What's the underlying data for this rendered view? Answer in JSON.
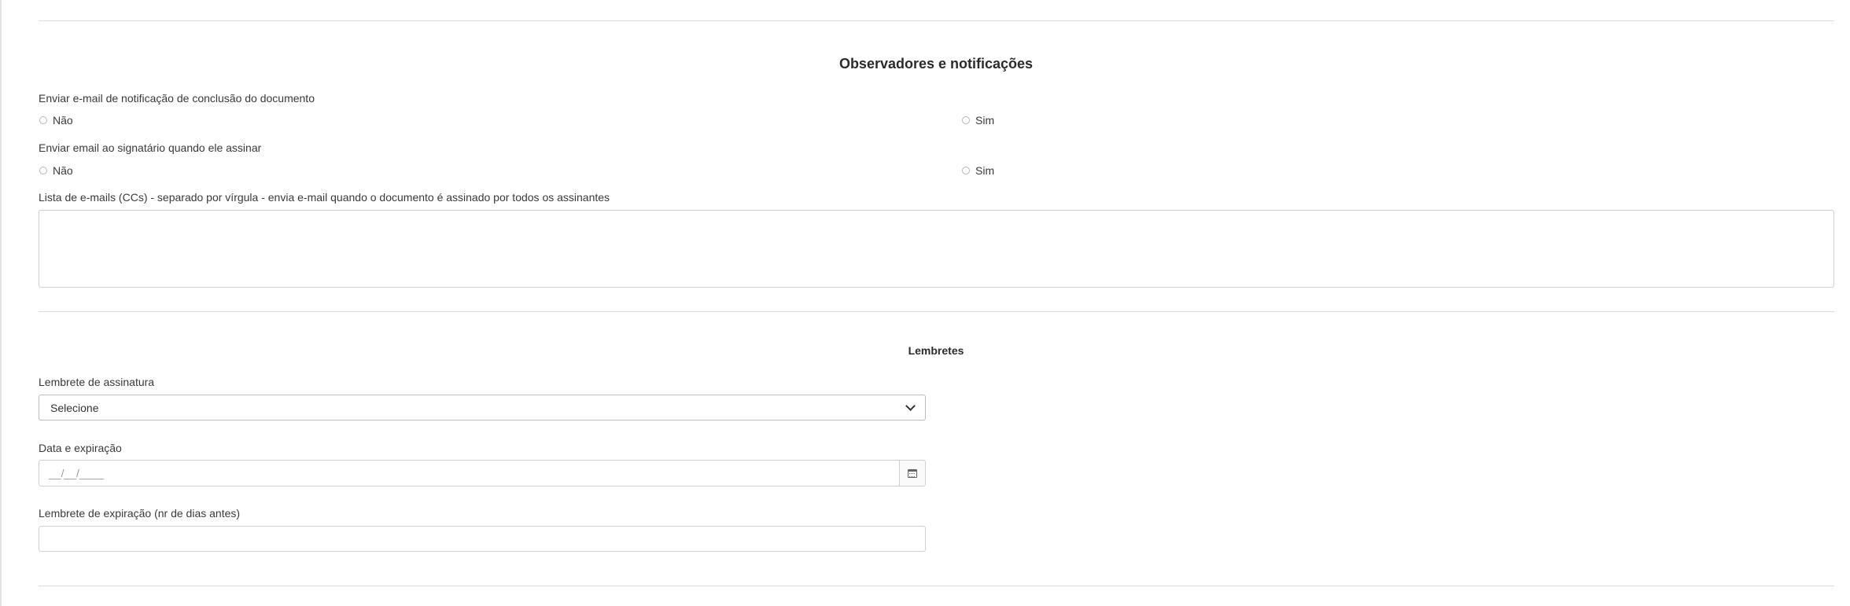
{
  "observers": {
    "title": "Observadores e notificações",
    "notify_completion": {
      "label": "Enviar e-mail de notificação de conclusão do documento",
      "option_no": "Não",
      "option_yes": "Sim"
    },
    "notify_signer": {
      "label": "Enviar email ao signatário quando ele assinar",
      "option_no": "Não",
      "option_yes": "Sim"
    },
    "cc_list": {
      "label": "Lista de e-mails (CCs) - separado por vírgula - envia e-mail quando o documento é assinado por todos os assinantes",
      "value": ""
    }
  },
  "reminders": {
    "title": "Lembretes",
    "signature_reminder": {
      "label": "Lembrete de assinatura",
      "selected": "Selecione"
    },
    "expiration_date": {
      "label": "Data e expiração",
      "placeholder": "__/__/____",
      "icon": "calendar-icon"
    },
    "expiration_reminder": {
      "label": "Lembrete de expiração (nr de dias antes)",
      "value": ""
    }
  }
}
